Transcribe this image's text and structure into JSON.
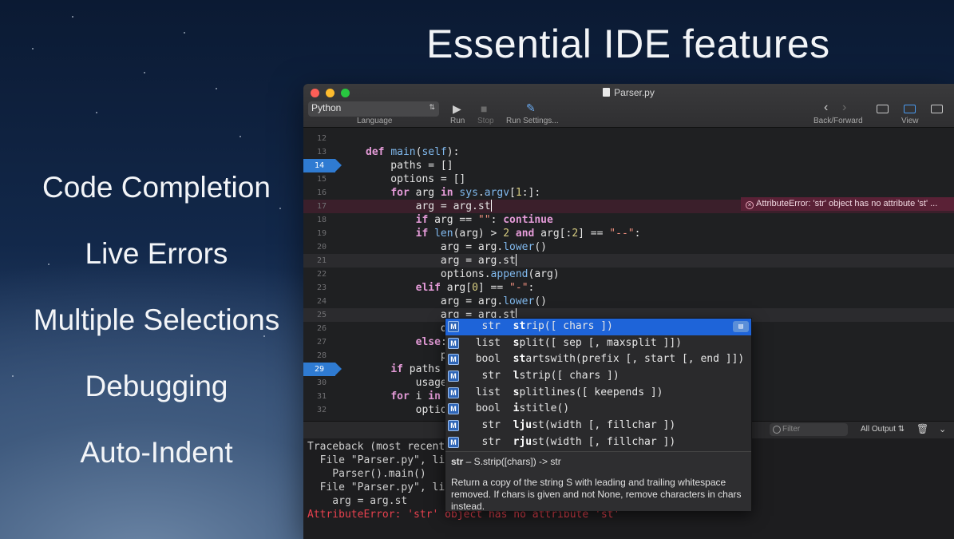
{
  "headline": "Essential IDE features",
  "features": [
    "Code Completion",
    "Live Errors",
    "Multiple Selections",
    "Debugging",
    "Auto-Indent"
  ],
  "window": {
    "title": "Parser.py",
    "language_value": "Python",
    "language_label": "Language",
    "run_label": "Run",
    "stop_label": "Stop",
    "run_settings_label": "Run Settings...",
    "back_forward_label": "Back/Forward",
    "view_label": "View"
  },
  "editor": {
    "breakpoint_lines": [
      14,
      29
    ],
    "error_line": 17,
    "highlighted_lines": [
      21,
      25
    ],
    "error_message": "AttributeError: 'str' object has no attribute 'st' ...",
    "lines": [
      {
        "num": "12",
        "text": ""
      },
      {
        "num": "13",
        "text": "def main(self):"
      },
      {
        "num": "14",
        "text": "    paths = []"
      },
      {
        "num": "15",
        "text": "    options = []"
      },
      {
        "num": "16",
        "text": "    for arg in sys.argv[1:]:"
      },
      {
        "num": "17",
        "text": "        arg = arg.st"
      },
      {
        "num": "18",
        "text": "        if arg == \"\": continue"
      },
      {
        "num": "19",
        "text": "        if len(arg) > 2 and arg[:2] == \"--\":"
      },
      {
        "num": "20",
        "text": "            arg = arg.lower()"
      },
      {
        "num": "21",
        "text": "            arg = arg.st"
      },
      {
        "num": "22",
        "text": "            options.append(arg)"
      },
      {
        "num": "23",
        "text": "        elif arg[0] == \"-\":"
      },
      {
        "num": "24",
        "text": "            arg = arg.lower()"
      },
      {
        "num": "25",
        "text": "            arg = arg.st"
      },
      {
        "num": "26",
        "text": "            o"
      },
      {
        "num": "27",
        "text": "        else:"
      },
      {
        "num": "28",
        "text": "            p"
      },
      {
        "num": "29",
        "text": "    if paths"
      },
      {
        "num": "30",
        "text": "        usage"
      },
      {
        "num": "31",
        "text": "    for i in"
      },
      {
        "num": "32",
        "text": "        optio"
      }
    ]
  },
  "completion": {
    "items": [
      {
        "type": "str",
        "match": "st",
        "rest": "rip([ chars ])"
      },
      {
        "type": "list",
        "match": "s",
        "rest": "plit([ sep [, maxsplit ]])"
      },
      {
        "type": "bool",
        "match": "st",
        "rest": "artswith(prefix [, start [, end ]])"
      },
      {
        "type": "str",
        "match": "l",
        "rest": "strip([ chars ])"
      },
      {
        "type": "list",
        "match": "s",
        "rest": "plitlines([ keepends ])"
      },
      {
        "type": "bool",
        "match": "i",
        "rest": "stitle()"
      },
      {
        "type": "str",
        "match": "lju",
        "rest": "st(width [, fillchar ])"
      },
      {
        "type": "str",
        "match": "rju",
        "rest": "st(width [, fillchar ])"
      }
    ],
    "kind_badge": "M",
    "doc_signature_name": "str",
    "doc_signature_rest": " – S.strip([chars]) -> str",
    "doc_description": "Return a copy of the string S with leading and trailing whitespace removed. If chars is given and not None, remove characters in chars instead."
  },
  "console_bar": {
    "filter_placeholder": "Filter",
    "output_select": "All Output"
  },
  "console": [
    {
      "text": "Traceback (most recent",
      "error": false
    },
    {
      "text": "  File \"Parser.py\", lin",
      "error": false
    },
    {
      "text": "    Parser().main()",
      "error": false
    },
    {
      "text": "  File \"Parser.py\", lin",
      "error": false
    },
    {
      "text": "    arg = arg.st",
      "error": false
    },
    {
      "text": "AttributeError: 'str' object has no attribute 'st'",
      "error": true
    }
  ]
}
